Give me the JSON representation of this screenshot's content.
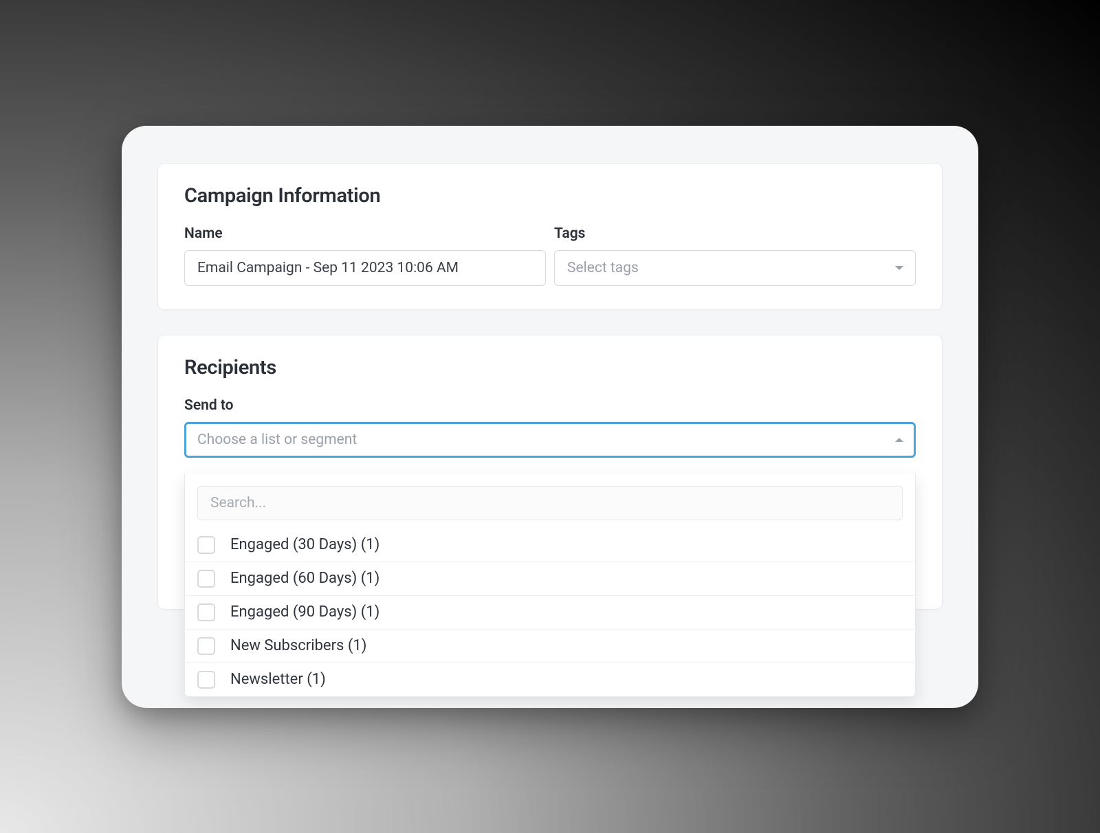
{
  "campaign_info": {
    "title": "Campaign Information",
    "name_label": "Name",
    "name_value": "Email Campaign - Sep 11 2023 10:06 AM",
    "tags_label": "Tags",
    "tags_placeholder": "Select tags"
  },
  "recipients": {
    "title": "Recipients",
    "send_to_label": "Send to",
    "send_to_placeholder": "Choose a list or segment",
    "search_placeholder": "Search...",
    "options": [
      {
        "label": "Engaged (30 Days) (1)"
      },
      {
        "label": "Engaged (60 Days) (1)"
      },
      {
        "label": "Engaged (90 Days) (1)"
      },
      {
        "label": "New Subscribers (1)"
      },
      {
        "label": "Newsletter (1)"
      }
    ]
  }
}
